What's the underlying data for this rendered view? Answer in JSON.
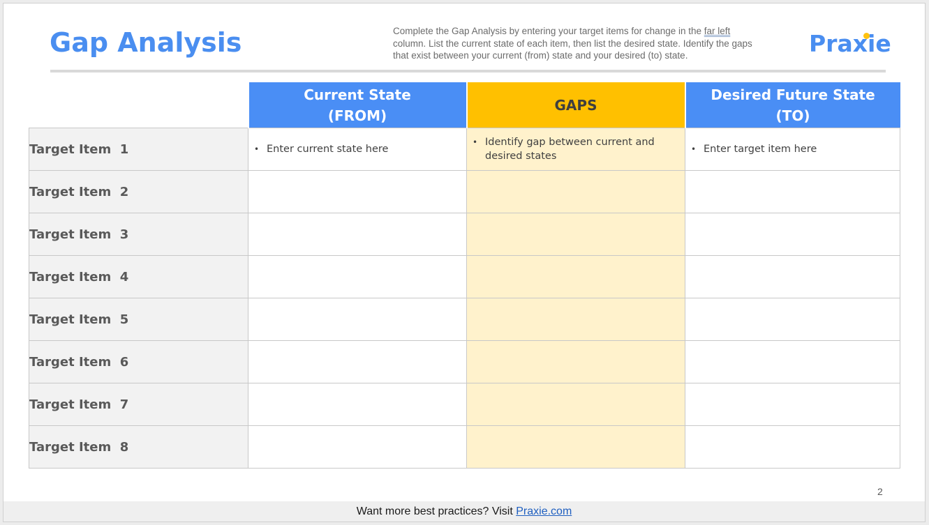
{
  "header": {
    "title": "Gap Analysis",
    "instructions_part1": "Complete the Gap Analysis by entering your target items for change in the ",
    "instructions_underlined": "far left",
    "instructions_part2": " column. List the current state of each item, then list the desired state. Identify the gaps that exist between your current (from) state and your desired (to) state.",
    "logo": "Praxie"
  },
  "colors": {
    "accent_blue": "#4a8ef5",
    "gaps_yellow": "#ffc000",
    "gaps_fill": "#fff2cc",
    "logo_dot": "#ffc20e"
  },
  "table": {
    "columns": [
      {
        "line1": "Current State",
        "line2": "(FROM)"
      },
      {
        "line1": "GAPS",
        "line2": ""
      },
      {
        "line1": "Desired Future State",
        "line2": "(TO)"
      }
    ],
    "rows": [
      {
        "label": "Target Item  1",
        "from": "Enter current state here",
        "gap": "Identify gap between current and desired states",
        "to": "Enter target item here"
      },
      {
        "label": "Target Item  2",
        "from": "",
        "gap": "",
        "to": ""
      },
      {
        "label": "Target Item  3",
        "from": "",
        "gap": "",
        "to": ""
      },
      {
        "label": "Target Item  4",
        "from": "",
        "gap": "",
        "to": ""
      },
      {
        "label": "Target Item  5",
        "from": "",
        "gap": "",
        "to": ""
      },
      {
        "label": "Target Item  6",
        "from": "",
        "gap": "",
        "to": ""
      },
      {
        "label": "Target Item  7",
        "from": "",
        "gap": "",
        "to": ""
      },
      {
        "label": "Target Item  8",
        "from": "",
        "gap": "",
        "to": ""
      }
    ]
  },
  "page_number": "2",
  "footer": {
    "text": "Want more best practices? Visit ",
    "link_text": "Praxie.com"
  }
}
